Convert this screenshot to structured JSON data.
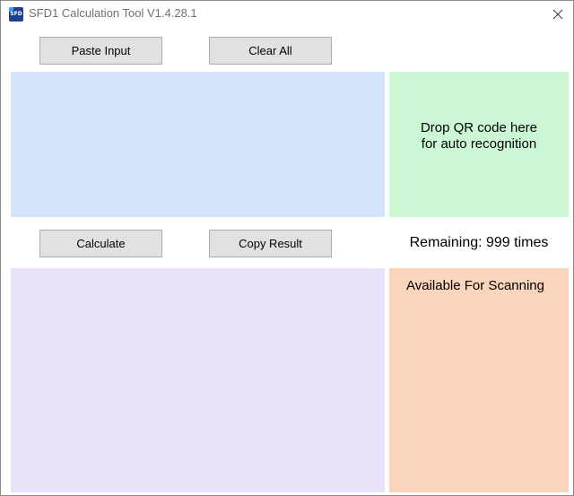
{
  "window": {
    "title": "SFD1 Calculation Tool V1.4.28.1",
    "icon_text": "SFD",
    "icon_name": "app-icon",
    "close_icon": "close-icon"
  },
  "toolbar_top": {
    "paste_label": "Paste Input",
    "clear_label": "Clear All"
  },
  "toolbar_mid": {
    "calculate_label": "Calculate",
    "copy_label": "Copy Result"
  },
  "qr_panel": {
    "line1": "Drop QR code here",
    "line2": "for auto recognition"
  },
  "status": {
    "remaining": "Remaining: 999 times",
    "scan_status": "Available For Scanning"
  },
  "input": {
    "value": ""
  },
  "result": {
    "value": ""
  },
  "colors": {
    "input_panel": "#d5e3f8",
    "qr_panel": "#ccf8d6",
    "result_panel": "#e9e2f8",
    "scan_panel": "#f8d5bb",
    "button_face": "#e1e1e1",
    "button_border": "#adadad"
  }
}
